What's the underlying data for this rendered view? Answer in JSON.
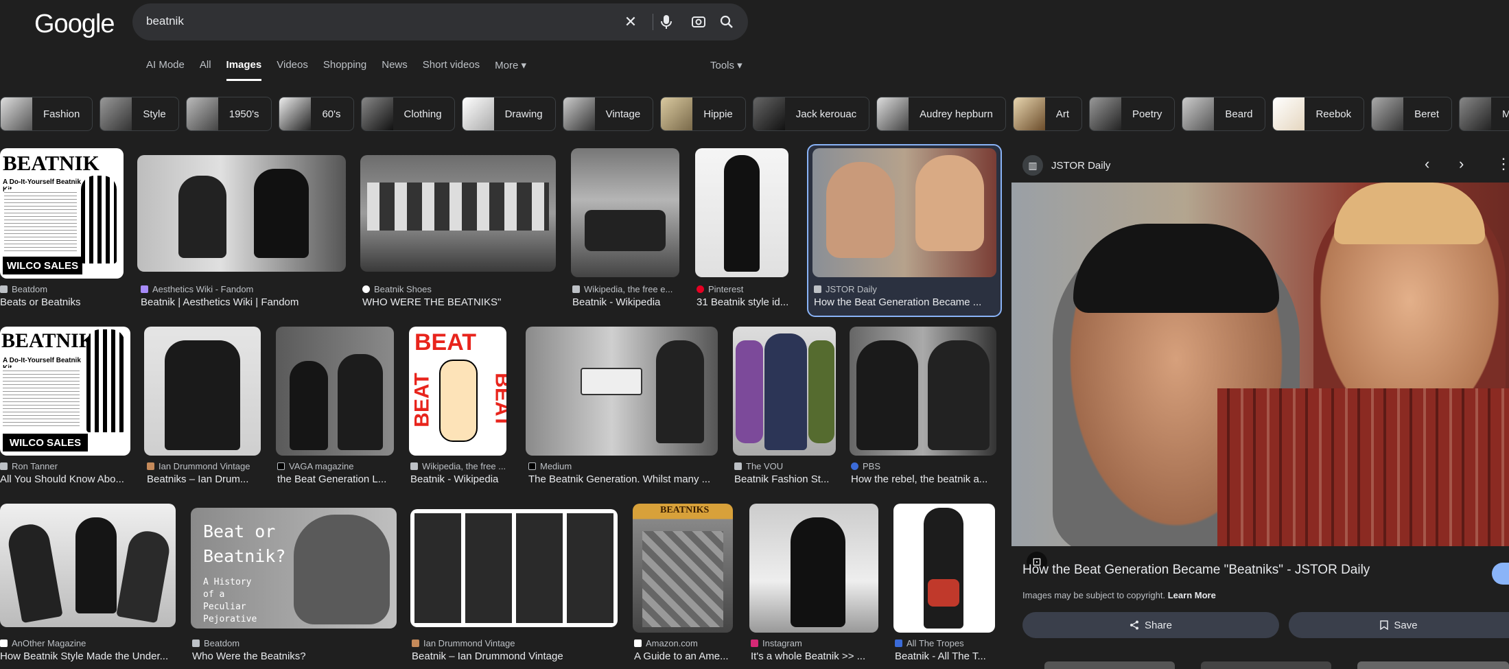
{
  "logo": "Google",
  "search": {
    "query": "beatnik"
  },
  "tabs": [
    "AI Mode",
    "All",
    "Images",
    "Videos",
    "Shopping",
    "News",
    "Short videos",
    "More ▾"
  ],
  "active_tab": "Images",
  "tools_label": "Tools ▾",
  "chips": [
    "Fashion",
    "Style",
    "1950's",
    "60's",
    "Clothing",
    "Drawing",
    "Vintage",
    "Hippie",
    "Jack kerouac",
    "Audrey hepburn",
    "Art",
    "Poetry",
    "Beard",
    "Reebok",
    "Beret",
    "Mountain re"
  ],
  "results": [
    {
      "src": "Beatdom",
      "title": "Beats or Beatniks"
    },
    {
      "src": "Aesthetics Wiki - Fandom",
      "title": "Beatnik | Aesthetics Wiki | Fandom"
    },
    {
      "src": "Beatnik Shoes",
      "title": "WHO WERE THE BEATNIKS\""
    },
    {
      "src": "Wikipedia, the free e...",
      "title": "Beatnik - Wikipedia"
    },
    {
      "src": "Pinterest",
      "title": "31 Beatnik style id..."
    },
    {
      "src": "JSTOR Daily",
      "title": "How the Beat Generation Became ..."
    },
    {
      "src": "Ron Tanner",
      "title": "All You Should Know Abo..."
    },
    {
      "src": "Ian Drummond Vintage",
      "title": "Beatniks – Ian Drum..."
    },
    {
      "src": "VAGA magazine",
      "title": "the Beat Generation L..."
    },
    {
      "src": "Wikipedia, the free ...",
      "title": "Beatnik - Wikipedia"
    },
    {
      "src": "Medium",
      "title": "The Beatnik Generation. Whilst many ..."
    },
    {
      "src": "The VOU",
      "title": "Beatnik Fashion St..."
    },
    {
      "src": "PBS",
      "title": "How the rebel, the beatnik a..."
    },
    {
      "src": "AnOther Magazine",
      "title": "How Beatnik Style Made the Under..."
    },
    {
      "src": "Beatdom",
      "title": "Who Were the Beatniks?"
    },
    {
      "src": "Ian Drummond Vintage",
      "title": "Beatnik – Ian Drummond Vintage"
    },
    {
      "src": "Amazon.com",
      "title": "A Guide to an Ame..."
    },
    {
      "src": "Instagram",
      "title": "It's a whole Beatnik >> ..."
    },
    {
      "src": "All The Tropes",
      "title": "Beatnik - All The T..."
    }
  ],
  "image_text": {
    "beatnik_kit": "BEATNIK",
    "kit_sub": "A Do-It-Yourself Beatnik Kit",
    "wilco": "WILCO SALES",
    "beat": "BEAT",
    "beat_or": "Beat or",
    "beatnik_q": "Beatnik?",
    "history": "A History of a Peculiar Pejorative",
    "beatniks_book": "BEATNIKS"
  },
  "panel": {
    "source": "JSTOR Daily",
    "title": "How the Beat Generation Became \"Beatniks\" - JSTOR Daily",
    "copyright": "Images may be subject to copyright.",
    "learn_more": "Learn More",
    "share": "Share",
    "save": "Save"
  }
}
